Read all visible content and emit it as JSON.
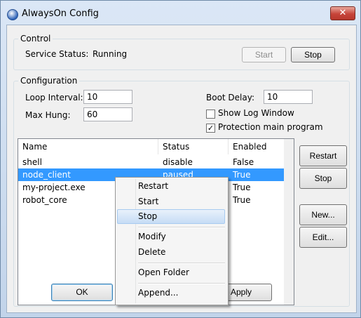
{
  "window": {
    "title": "AlwaysOn Config",
    "close_glyph": "✕"
  },
  "control": {
    "legend": "Control",
    "status_label": "Service Status:",
    "status_value": "Running",
    "start_label": "Start",
    "stop_label": "Stop"
  },
  "configuration": {
    "legend": "Configuration",
    "loop_interval_label": "Loop Interval:",
    "loop_interval_value": "10",
    "max_hung_label": "Max Hung:",
    "max_hung_value": "60",
    "boot_delay_label": "Boot Delay:",
    "boot_delay_value": "10",
    "show_log_label": "Show Log Window",
    "show_log_checked": false,
    "protection_label": "Protection main program",
    "protection_checked": true
  },
  "list": {
    "columns": [
      "Name",
      "Status",
      "Enabled"
    ],
    "rows": [
      {
        "name": "shell",
        "status": "disable",
        "enabled": "False"
      },
      {
        "name": "node_client",
        "status": "paused",
        "enabled": "True"
      },
      {
        "name": "my-project.exe",
        "status": "",
        "enabled": "True"
      },
      {
        "name": "robot_core",
        "status": "",
        "enabled": "True"
      }
    ],
    "selected_index": 1
  },
  "side_buttons": {
    "restart": "Restart",
    "stop": "Stop",
    "new": "New...",
    "edit": "Edit..."
  },
  "context_menu": {
    "items": [
      "Restart",
      "Start",
      "Stop",
      "Modify",
      "Delete",
      "Open Folder",
      "Append..."
    ],
    "highlighted": "Stop"
  },
  "bottom_buttons": {
    "ok": "OK",
    "apply": "Apply"
  },
  "colors": {
    "selection": "#3399ff",
    "close_button": "#c6453a"
  }
}
